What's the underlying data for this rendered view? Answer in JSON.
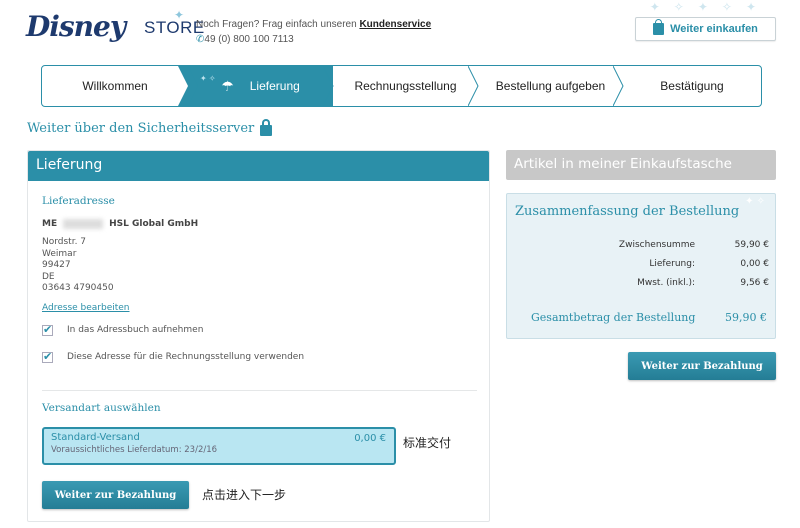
{
  "header": {
    "logo_disney": "Disney",
    "logo_store": "STORE",
    "help_text": "Noch Fragen? Frag einfach unseren",
    "help_link": "Kundenservice",
    "phone": "49 (0) 800 100 7113",
    "continue_shopping": "Weiter einkaufen"
  },
  "steps": [
    {
      "label": "Willkommen"
    },
    {
      "label": "Lieferung"
    },
    {
      "label": "Rechnungsstellung"
    },
    {
      "label": "Bestellung aufgeben"
    },
    {
      "label": "Bestätigung"
    }
  ],
  "secure_text": "Weiter über den Sicherheitsserver",
  "delivery": {
    "heading": "Lieferung",
    "address_title": "Lieferadresse",
    "name_prefix": "ME",
    "name_suffix": "HSL Global GmbH",
    "street": "Nordstr. 7",
    "city": "Weimar",
    "zip": "99427",
    "country": "DE",
    "phone": "03643 4790450",
    "edit_address": "Adresse bearbeiten",
    "check_addressbook": "In das Adressbuch aufnehmen",
    "check_billing": "Diese Adresse für die Rechnungsstellung verwenden",
    "shipping_title": "Versandart auswählen",
    "shipping_name": "Standard-Versand",
    "shipping_price": "0,00 €",
    "shipping_date": "Voraussichtliches Lieferdatum: 23/2/16",
    "note_shipping": "标准交付",
    "button_continue": "Weiter zur Bezahlung",
    "note_next": "点击进入下一步"
  },
  "cart": {
    "heading": "Artikel in meiner Einkaufstasche"
  },
  "summary": {
    "title": "Zusammenfassung der Bestellung",
    "rows": [
      {
        "label": "Zwischensumme",
        "value": "59,90 €"
      },
      {
        "label": "Lieferung:",
        "value": "0,00 €"
      },
      {
        "label": "Mwst. (inkl.):",
        "value": "9,56 €"
      }
    ],
    "total_label": "Gesamtbetrag der Bestellung",
    "total_value": "59,90 €",
    "button_continue": "Weiter zur Bezahlung"
  },
  "colors": {
    "accent": "#2b8fa8",
    "brand_dark": "#1e3a6e",
    "shipping_highlight": "#b9e6f2",
    "summary_bg": "#e8f2f6",
    "cart_header": "#c8c8c8"
  }
}
